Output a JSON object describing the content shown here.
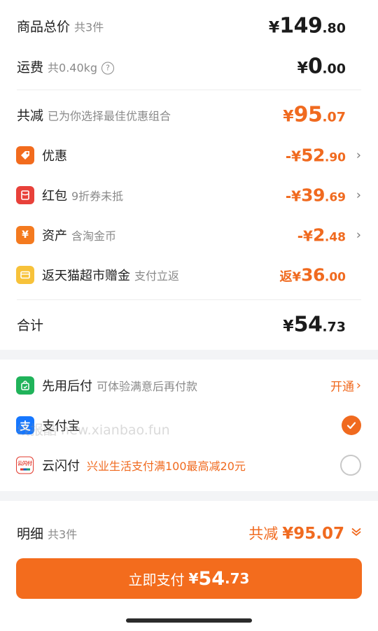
{
  "summary": {
    "goods_total": {
      "label": "商品总价",
      "sub": "共3件",
      "yen": "¥",
      "int": "149",
      "cent": ".80"
    },
    "shipping": {
      "label": "运费",
      "sub": "共0.40kg",
      "help": "?",
      "yen": "¥",
      "int": "0",
      "cent": ".00"
    },
    "total_discount": {
      "label": "共减",
      "sub": "已为你选择最佳优惠组合",
      "yen": "¥",
      "int": "95",
      "cent": ".07"
    },
    "items": [
      {
        "label": "优惠",
        "sub": "",
        "prefix": "-¥",
        "int": "52",
        "cent": ".90",
        "icon": "tag-icon",
        "color": "#f26b1d"
      },
      {
        "label": "红包",
        "sub": "9折券未抵",
        "prefix": "-¥",
        "int": "39",
        "cent": ".69",
        "icon": "red-packet-icon",
        "color": "#e8413a"
      },
      {
        "label": "资产",
        "sub": "含淘金币",
        "prefix": "-¥",
        "int": "2",
        "cent": ".48",
        "icon": "yen-asset-icon",
        "color": "#f47a1f"
      },
      {
        "label": "返天猫超市赠金",
        "sub": "支付立返",
        "prefix": "返¥",
        "int": "36",
        "cent": ".00",
        "icon": "wallet-card-icon",
        "color": "#f7c23a"
      }
    ],
    "subtotal": {
      "label": "合计",
      "yen": "¥",
      "int": "54",
      "cent": ".73"
    }
  },
  "payment": {
    "bnpl": {
      "label": "先用后付",
      "sub": "可体验满意后再付款",
      "action": "开通",
      "icon": "bag-check-icon"
    },
    "alipay": {
      "label": "支付宝",
      "icon": "alipay-icon",
      "selected": true
    },
    "unionpay": {
      "label": "云闪付",
      "promo": "兴业生活支付满100最高减20元",
      "icon": "cloud-quickpass-icon",
      "icon_text": "云闪付",
      "selected": false
    }
  },
  "watermark": "线报酷 new.xianbao.fun",
  "footer": {
    "detail_label": "明细",
    "detail_sub": "共3件",
    "discount_label": "共减",
    "discount_value": "¥95.07",
    "pay_label": "立即支付",
    "pay_yen": "¥",
    "pay_int": "54",
    "pay_cent": ".73"
  },
  "colors": {
    "accent": "#f06a1f",
    "text": "#1f1f1f",
    "muted": "#8a8a8a"
  }
}
